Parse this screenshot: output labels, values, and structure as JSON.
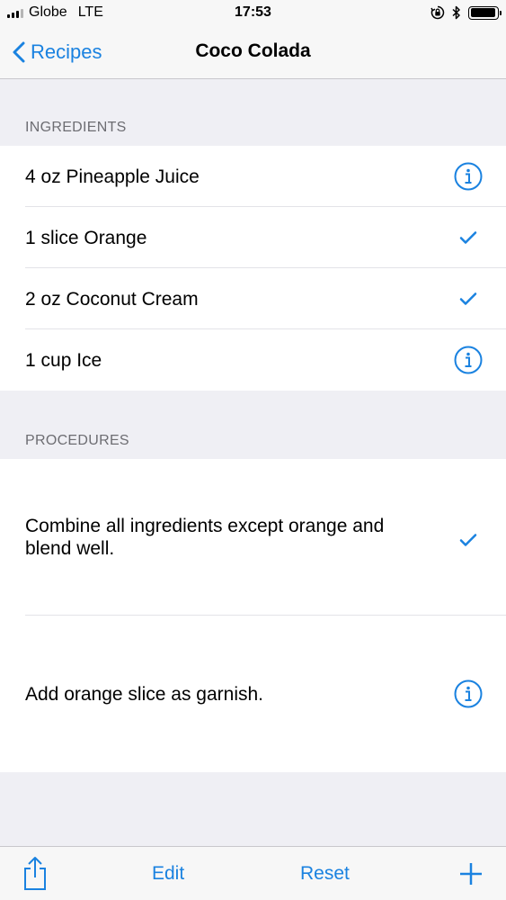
{
  "status_bar": {
    "carrier": "Globe",
    "network": "LTE",
    "time": "17:53",
    "battery_level": 0.95
  },
  "nav": {
    "back_label": "Recipes",
    "title": "Coco Colada"
  },
  "ingredients": {
    "header": "INGREDIENTS",
    "items": [
      {
        "label": "4 oz Pineapple Juice",
        "accessory": "info-icon"
      },
      {
        "label": "1 slice Orange",
        "accessory": "checkmark-icon"
      },
      {
        "label": "2 oz Coconut Cream",
        "accessory": "checkmark-icon"
      },
      {
        "label": "1 cup Ice",
        "accessory": "info-icon"
      }
    ]
  },
  "procedures": {
    "header": "PROCEDURES",
    "items": [
      {
        "line1": "Combine all ingredients except orange and",
        "line2": "blend well.",
        "accessory": "checkmark-icon"
      },
      {
        "line1": "Add orange slice as garnish.",
        "accessory": "info-icon"
      }
    ]
  },
  "toolbar": {
    "edit_label": "Edit",
    "reset_label": "Reset"
  },
  "colors": {
    "accent": "#1a82e0",
    "background": "#efeff4",
    "section_header": "#6d6d72"
  }
}
